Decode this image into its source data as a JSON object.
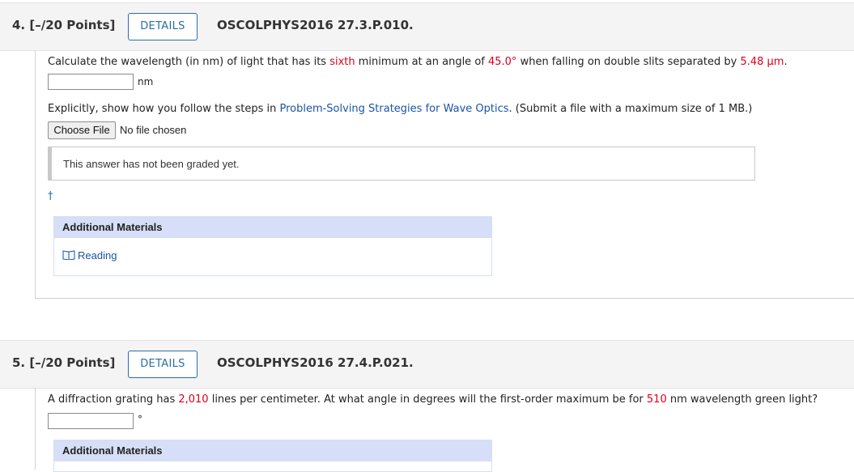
{
  "q4": {
    "number": "4.  [–/20 Points]",
    "details": "DETAILS",
    "code": "OSCOLPHYS2016 27.3.P.010.",
    "text": {
      "p1": "Calculate the wavelength (in nm) of light that has its ",
      "red1": "sixth",
      "p2": " minimum at an angle of ",
      "red2": "45.0°",
      "p3": " when falling on double slits separated by ",
      "red3": "5.48 μm",
      "p4": "."
    },
    "unit": "nm",
    "explain": {
      "p1": "Explicitly, show how you follow the steps in ",
      "link": "Problem-Solving Strategies for Wave Optics",
      "p2": ". (Submit a file with a maximum size of 1 MB.)"
    },
    "choose_file": "Choose File",
    "no_file": "No file chosen",
    "graded": "This answer has not been graded yet.",
    "dagger": "†",
    "additional": "Additional Materials",
    "reading": "Reading"
  },
  "q5": {
    "number": "5.  [–/20 Points]",
    "details": "DETAILS",
    "code": "OSCOLPHYS2016 27.4.P.021.",
    "text": {
      "p1": "A diffraction grating has ",
      "red1": "2,010",
      "p2": " lines per centimeter. At what angle in degrees will the first-order maximum be for ",
      "red2": "510",
      "p3": " nm wavelength green light?"
    },
    "unit": "°",
    "additional": "Additional Materials"
  }
}
